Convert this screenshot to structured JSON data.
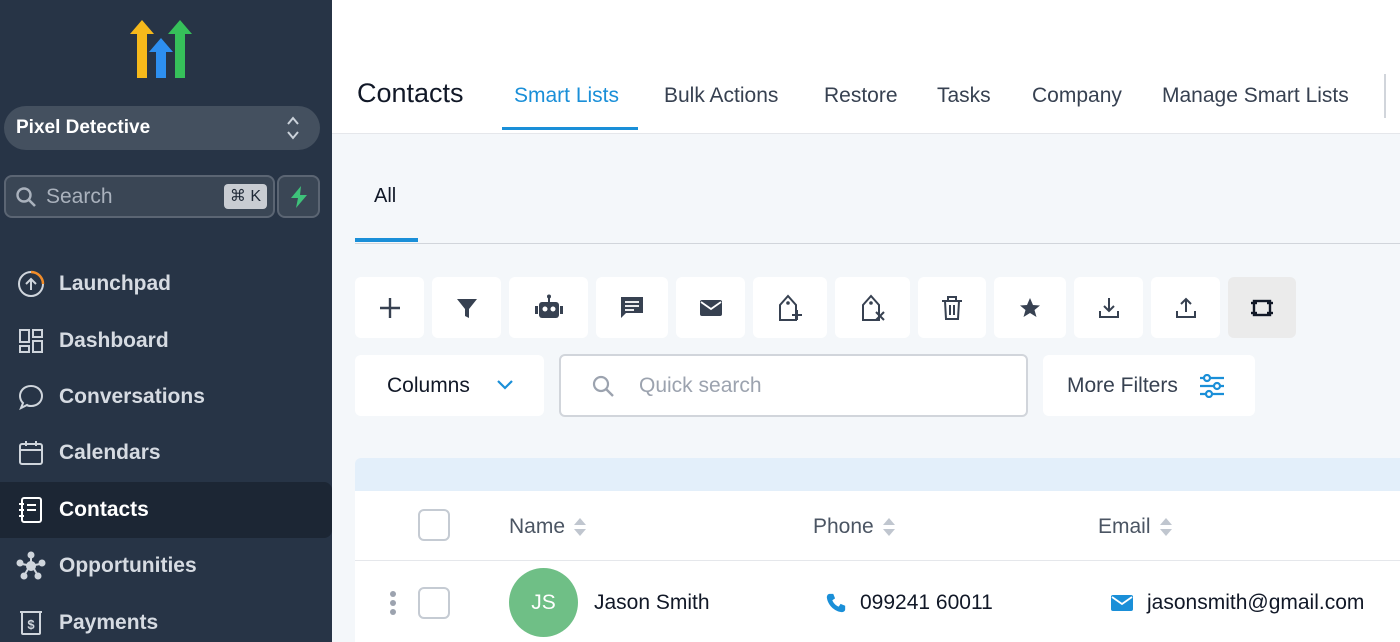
{
  "sidebar": {
    "location": "Pixel Detective",
    "search_placeholder": "Search",
    "search_shortcut": "⌘ K",
    "items": [
      {
        "label": "Launchpad",
        "icon": "launchpad-icon"
      },
      {
        "label": "Dashboard",
        "icon": "dashboard-icon"
      },
      {
        "label": "Conversations",
        "icon": "chat-bubble-icon"
      },
      {
        "label": "Calendars",
        "icon": "calendar-icon"
      },
      {
        "label": "Contacts",
        "icon": "contacts-book-icon",
        "active": true
      },
      {
        "label": "Opportunities",
        "icon": "opportunities-icon"
      },
      {
        "label": "Payments",
        "icon": "payments-icon"
      }
    ]
  },
  "header": {
    "title": "Contacts",
    "tabs": [
      "Smart Lists",
      "Bulk Actions",
      "Restore",
      "Tasks",
      "Company",
      "Manage Smart Lists"
    ],
    "active_tab": "Smart Lists"
  },
  "subtabs": {
    "all": "All"
  },
  "toolbar": {
    "tools": [
      "add-icon",
      "filter-icon",
      "robot-icon",
      "sms-icon",
      "email-icon",
      "add-tag-icon",
      "remove-tag-icon",
      "delete-icon",
      "star-icon",
      "import-icon",
      "export-icon",
      "restore-icon"
    ]
  },
  "filters": {
    "columns_label": "Columns",
    "search_placeholder": "Quick search",
    "more_filters_label": "More Filters"
  },
  "table": {
    "columns": [
      "Name",
      "Phone",
      "Email"
    ],
    "rows": [
      {
        "initials": "JS",
        "name": "Jason Smith",
        "phone": "099241 60011",
        "email": "jasonsmith@gmail.com"
      }
    ]
  },
  "colors": {
    "accent": "#1a8fd8",
    "sidebar": "#273446",
    "avatar": "#6fbf86"
  }
}
